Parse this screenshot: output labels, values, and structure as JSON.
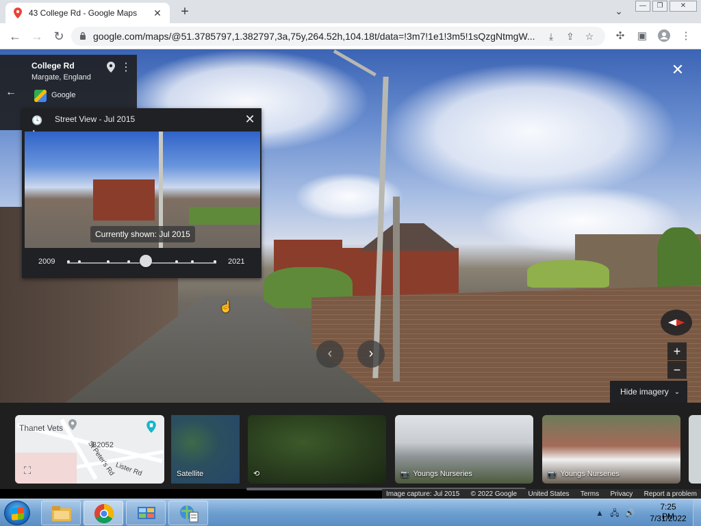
{
  "browser": {
    "tab_title": "43 College Rd - Google Maps",
    "url": "google.com/maps/@51.3785797,1.382797,3a,75y,264.52h,104.18t/data=!3m7!1e1!3m5!1sQzgNtmgW..."
  },
  "place_card": {
    "title": "College Rd",
    "subtitle": "Margate, England",
    "source": "Google"
  },
  "time_panel": {
    "title": "Street View - Jul 2015",
    "currently_shown": "Currently shown: Jul 2015",
    "start_year": "2009",
    "end_year": "2021",
    "captures_count": 9,
    "selected_index": 4
  },
  "controls": {
    "hide_imagery": "Hide imagery",
    "zoom_in": "+",
    "zoom_out": "−"
  },
  "imagery_strip": {
    "map": {
      "labels": [
        "Thanet Vets",
        "B2052",
        "St Peter's Rd",
        "Lister Rd"
      ]
    },
    "satellite_label": "Satellite",
    "photos": [
      {
        "label": ""
      },
      {
        "label": "Youngs Nurseries"
      },
      {
        "label": "Youngs Nurseries"
      }
    ]
  },
  "footer": {
    "capture": "Image capture: Jul 2015",
    "copyright": "© 2022 Google",
    "country": "United States",
    "terms": "Terms",
    "privacy": "Privacy",
    "report": "Report a problem"
  },
  "taskbar": {
    "time": "7:25 PM",
    "date": "7/31/2022"
  },
  "colors": {
    "panel_bg": "#202124",
    "compass_red": "#d93025",
    "taskbar": "#6e9fd0"
  }
}
